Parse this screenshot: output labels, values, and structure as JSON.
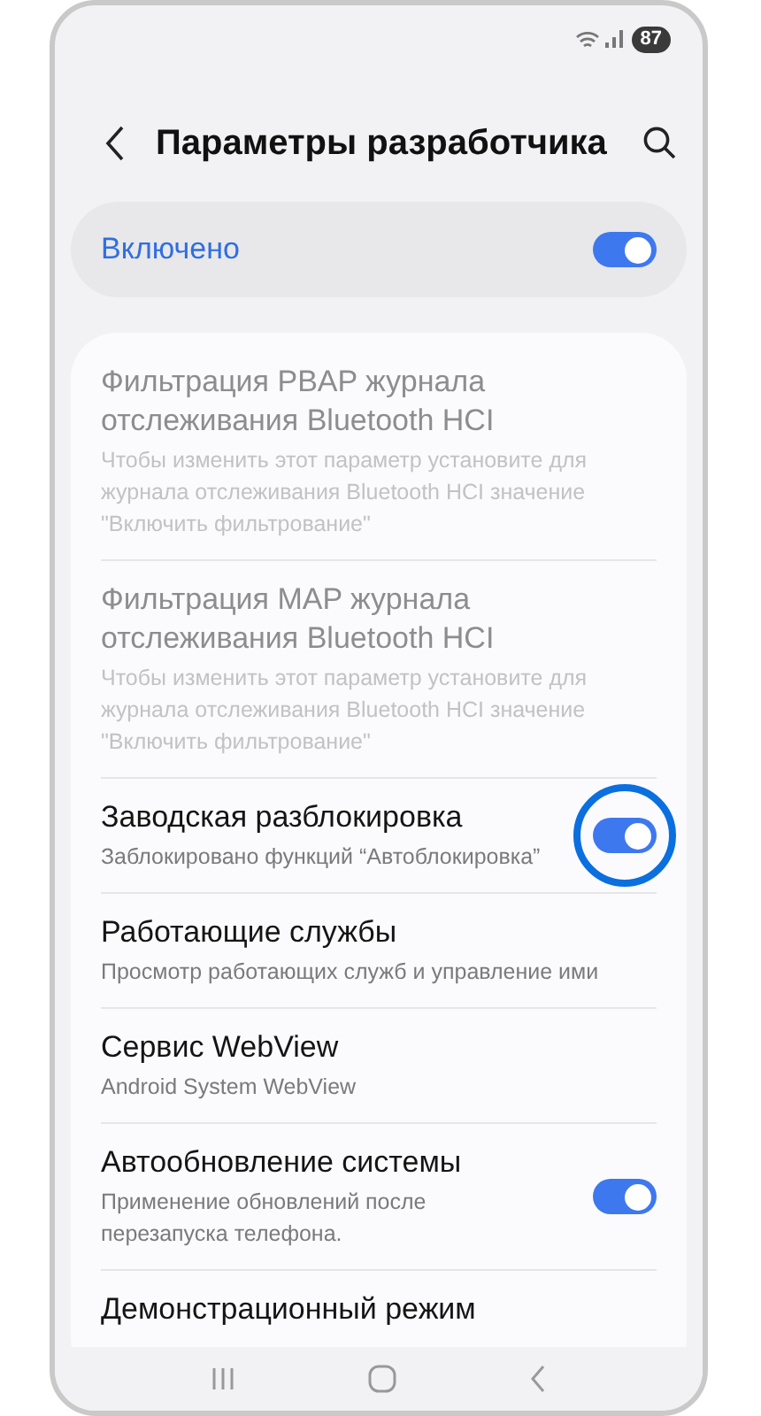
{
  "status_bar": {
    "battery": "87"
  },
  "header": {
    "title": "Параметры разработчика"
  },
  "master_switch": {
    "label": "Включено",
    "on": true
  },
  "settings": [
    {
      "kind": "info",
      "title": "Фильтрация PBAP журнала отслеживания Bluetooth HCI",
      "subtitle": "Чтобы изменить этот параметр установите для журнала отслеживания Bluetooth HCI значение \"Включить фильтрование\"",
      "disabled": true
    },
    {
      "kind": "info",
      "title": "Фильтрация MAP журнала отслеживания Bluetooth HCI",
      "subtitle": "Чтобы изменить этот параметр установите для журнала отслеживания Bluetooth HCI значение \"Включить фильтрование\"",
      "disabled": true
    },
    {
      "kind": "toggle",
      "title": "Заводская разблокировка",
      "subtitle": "Заблокировано функций “Автоблокировка”",
      "disabled": false,
      "on": true,
      "highlighted": true
    },
    {
      "kind": "info",
      "title": "Работающие службы",
      "subtitle": "Просмотр работающих служб и управление ими",
      "disabled": false
    },
    {
      "kind": "info",
      "title": "Сервис WebView",
      "subtitle": "Android System WebView",
      "disabled": false
    },
    {
      "kind": "toggle",
      "title": "Автообновление системы",
      "subtitle": "Применение обновлений после перезапуска телефона.",
      "disabled": false,
      "on": true
    },
    {
      "kind": "info",
      "title": "Демонстрационный режим",
      "disabled": false
    }
  ]
}
